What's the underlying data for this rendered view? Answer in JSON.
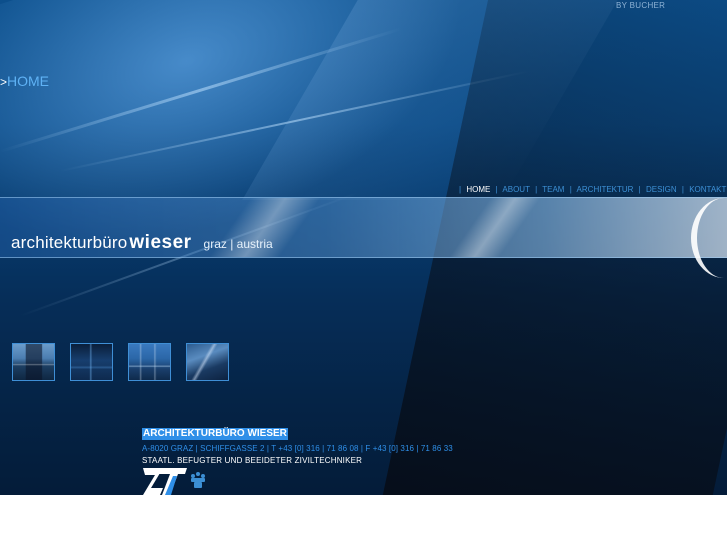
{
  "header": {
    "byline": "BY BUCHER"
  },
  "page_title": {
    "prefix": ">",
    "label": "HOME"
  },
  "nav": {
    "items": [
      {
        "label": "HOME",
        "active": true
      },
      {
        "label": "ABOUT",
        "active": false
      },
      {
        "label": "TEAM",
        "active": false
      },
      {
        "label": "ARCHITEKTUR",
        "active": false
      },
      {
        "label": "DESIGN",
        "active": false
      },
      {
        "label": "KONTAKT",
        "active": false
      }
    ],
    "separator": "|"
  },
  "brand": {
    "name_light": "architekturbüro",
    "name_bold": "wieser",
    "location": "graz | austria"
  },
  "thumbnails": [
    {
      "name": "thumbnail-building-exterior-1"
    },
    {
      "name": "thumbnail-interior-dark"
    },
    {
      "name": "thumbnail-building-exterior-2"
    },
    {
      "name": "thumbnail-interior-stairs"
    }
  ],
  "contact": {
    "company": "ARCHITEKTURBÜRO WIESER",
    "address": "A-8020 GRAZ | SCHIFFGASSE 2 | T +43 [0] 316 | 71 86 08 | F +43 [0] 316 | 71 86 33",
    "title": "STAATL. BEFUGTER UND BEEIDETER ZIVILTECHNIKER"
  },
  "logo": {
    "icon": "zt-logo-icon"
  },
  "colors": {
    "accent": "#2f8fe8",
    "title_blue": "#5fb2f5",
    "nav_blue": "#3c8fd4",
    "background_top": "#0c4f8c",
    "background_bottom": "#041c39"
  }
}
